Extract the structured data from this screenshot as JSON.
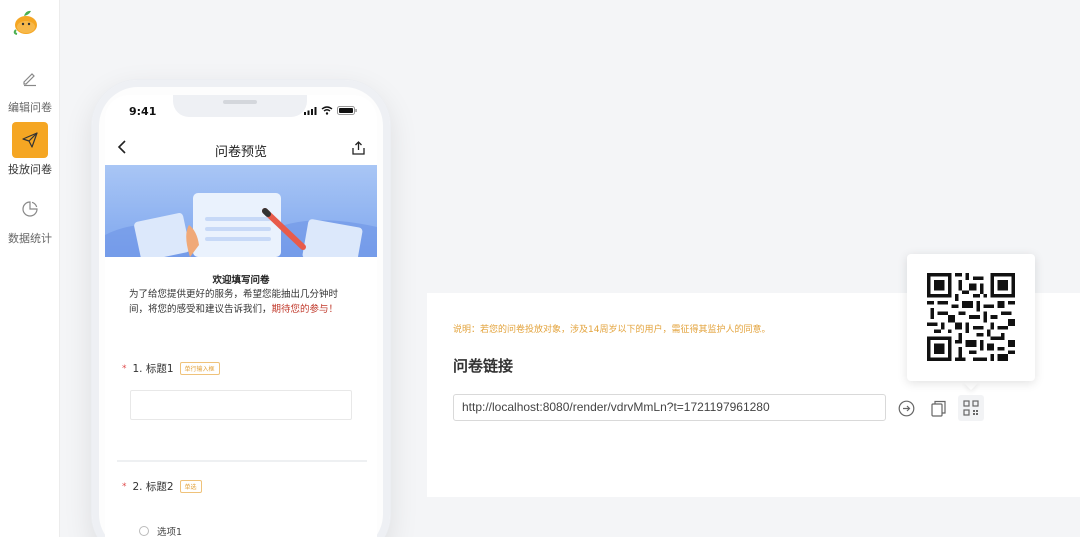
{
  "sidebar": {
    "items": [
      {
        "label": "编辑问卷",
        "icon": "edit-icon",
        "active": false
      },
      {
        "label": "投放问卷",
        "icon": "send-icon",
        "active": true
      },
      {
        "label": "数据统计",
        "icon": "pie-chart-icon",
        "active": false
      }
    ]
  },
  "phone": {
    "time": "9:41",
    "title": "问卷预览",
    "welcome": "欢迎填写问卷",
    "intro_text": "为了给您提供更好的服务，希望您能抽出几分钟时间，将您的感受和建议告诉我们，",
    "intro_highlight": "期待您的参与！",
    "questions": [
      {
        "title": "1. 标题1",
        "tag": "单行输入框"
      },
      {
        "title": "2. 标题2",
        "tag": "单选"
      }
    ],
    "options": [
      "选项1"
    ]
  },
  "panel": {
    "note": "说明：若您的问卷投放对象，涉及14周岁以下的用户，需征得其监护人的同意。",
    "link_title": "问卷链接",
    "url": "http://localhost:8080/render/vdrvMmLn?t=1721197961280"
  },
  "colors": {
    "accent": "#f5a623",
    "warning_text": "#e3a33c",
    "highlight": "#c0392b"
  }
}
